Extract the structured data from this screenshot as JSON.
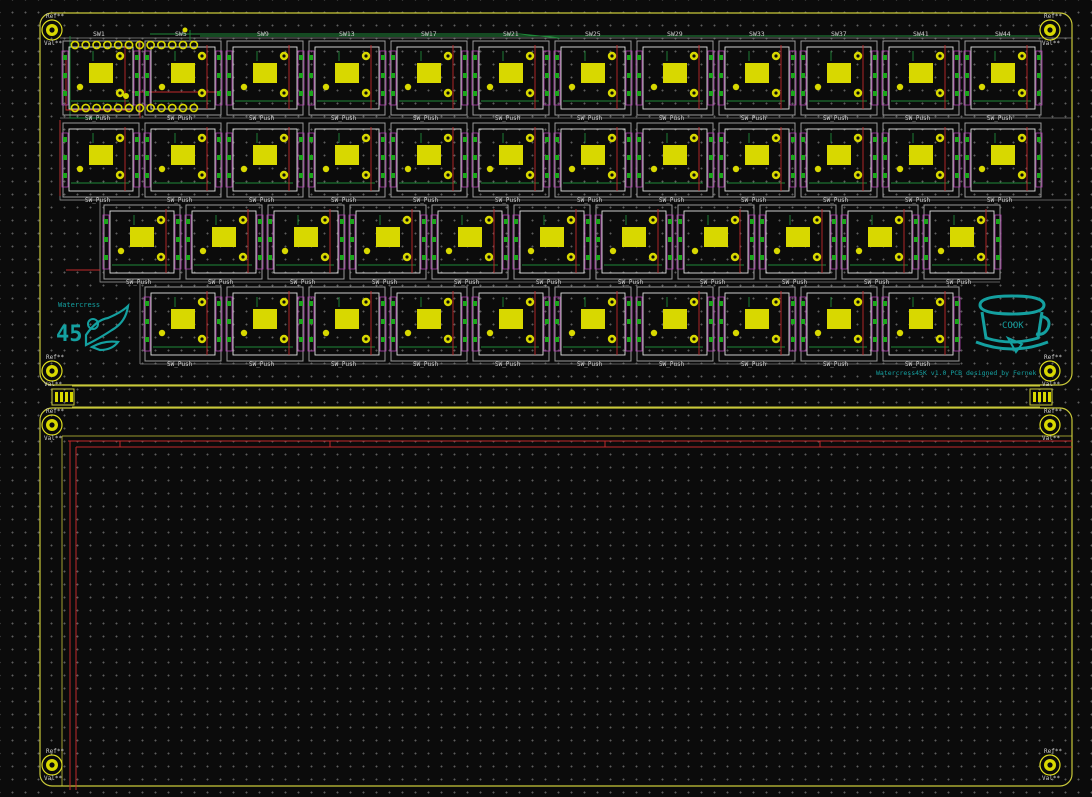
{
  "board": {
    "switch_footprint_label": "SW_Push",
    "mount_hole_ref": "Ref**",
    "mount_hole_val": "Val**",
    "logo_number": "45",
    "logo_word": "Watercress",
    "cup_label": "COOK",
    "credit_text": "Watercress45K v1.0 PCB designed by Fernek"
  },
  "switch_refs_row1": [
    "SW1",
    "SW5",
    "SW9",
    "SW13",
    "SW17",
    "SW21",
    "SW25",
    "SW29",
    "SW33",
    "SW37",
    "SW41",
    "SW44"
  ],
  "colors": {
    "background": "#0b0b0b",
    "grid_dot": "#5d5d5d",
    "edge_cuts": "#c9c93a",
    "courtyard": "#9a9a9a",
    "pad": "#d8d800",
    "front_copper": "#c0292b",
    "back_copper": "#1f8a3a",
    "silk_purple": "#b040b0",
    "logo": "#14a0a0"
  }
}
